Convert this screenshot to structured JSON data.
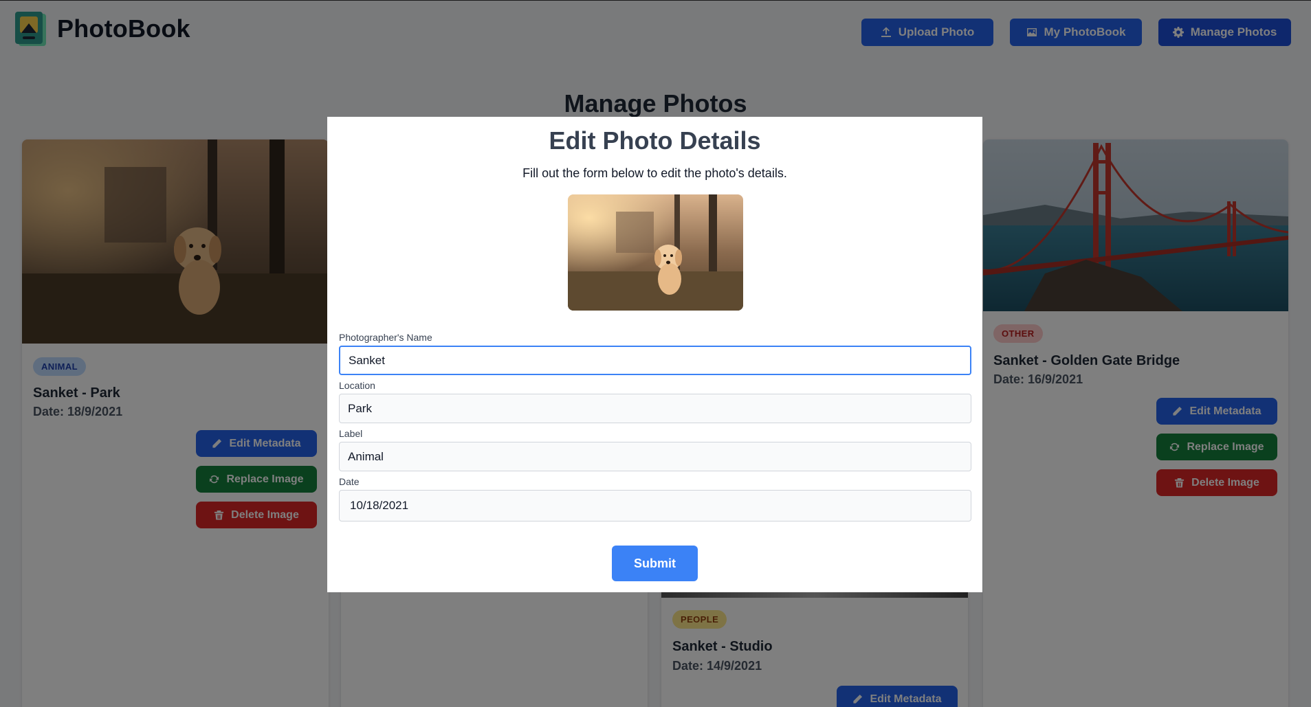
{
  "app": {
    "name": "PhotoBook"
  },
  "nav": {
    "upload_label": "Upload Photo",
    "photobook_label": "My PhotoBook",
    "manage_label": "Manage Photos"
  },
  "page": {
    "title": "Manage Photos"
  },
  "actions": {
    "edit_label": "Edit Metadata",
    "replace_label": "Replace Image",
    "delete_label": "Delete Image"
  },
  "cards": [
    {
      "badge": "ANIMAL",
      "title": "Sanket - Park",
      "date": "Date: 18/9/2021"
    },
    {
      "badge": "OTHER",
      "title": "Sanket - Golden Gate Bridge",
      "date": "Date: 16/9/2021"
    },
    {
      "badge": "PEOPLE",
      "title": "Sanket - Studio",
      "date": "Date: 14/9/2021"
    }
  ],
  "modal": {
    "title": "Edit Photo Details",
    "subtitle": "Fill out the form below to edit the photo's details.",
    "fields": {
      "name_label": "Photographer's Name",
      "name_value": "Sanket",
      "location_label": "Location",
      "location_value": "Park",
      "label_label": "Label",
      "label_value": "Animal",
      "date_label": "Date",
      "date_value": "10/18/2021"
    },
    "submit_label": "Submit"
  },
  "colors": {
    "primary": "#2563eb",
    "primary_dark": "#1d4ed8",
    "success": "#15803d",
    "danger": "#dc2626",
    "submit": "#3b82f6"
  }
}
